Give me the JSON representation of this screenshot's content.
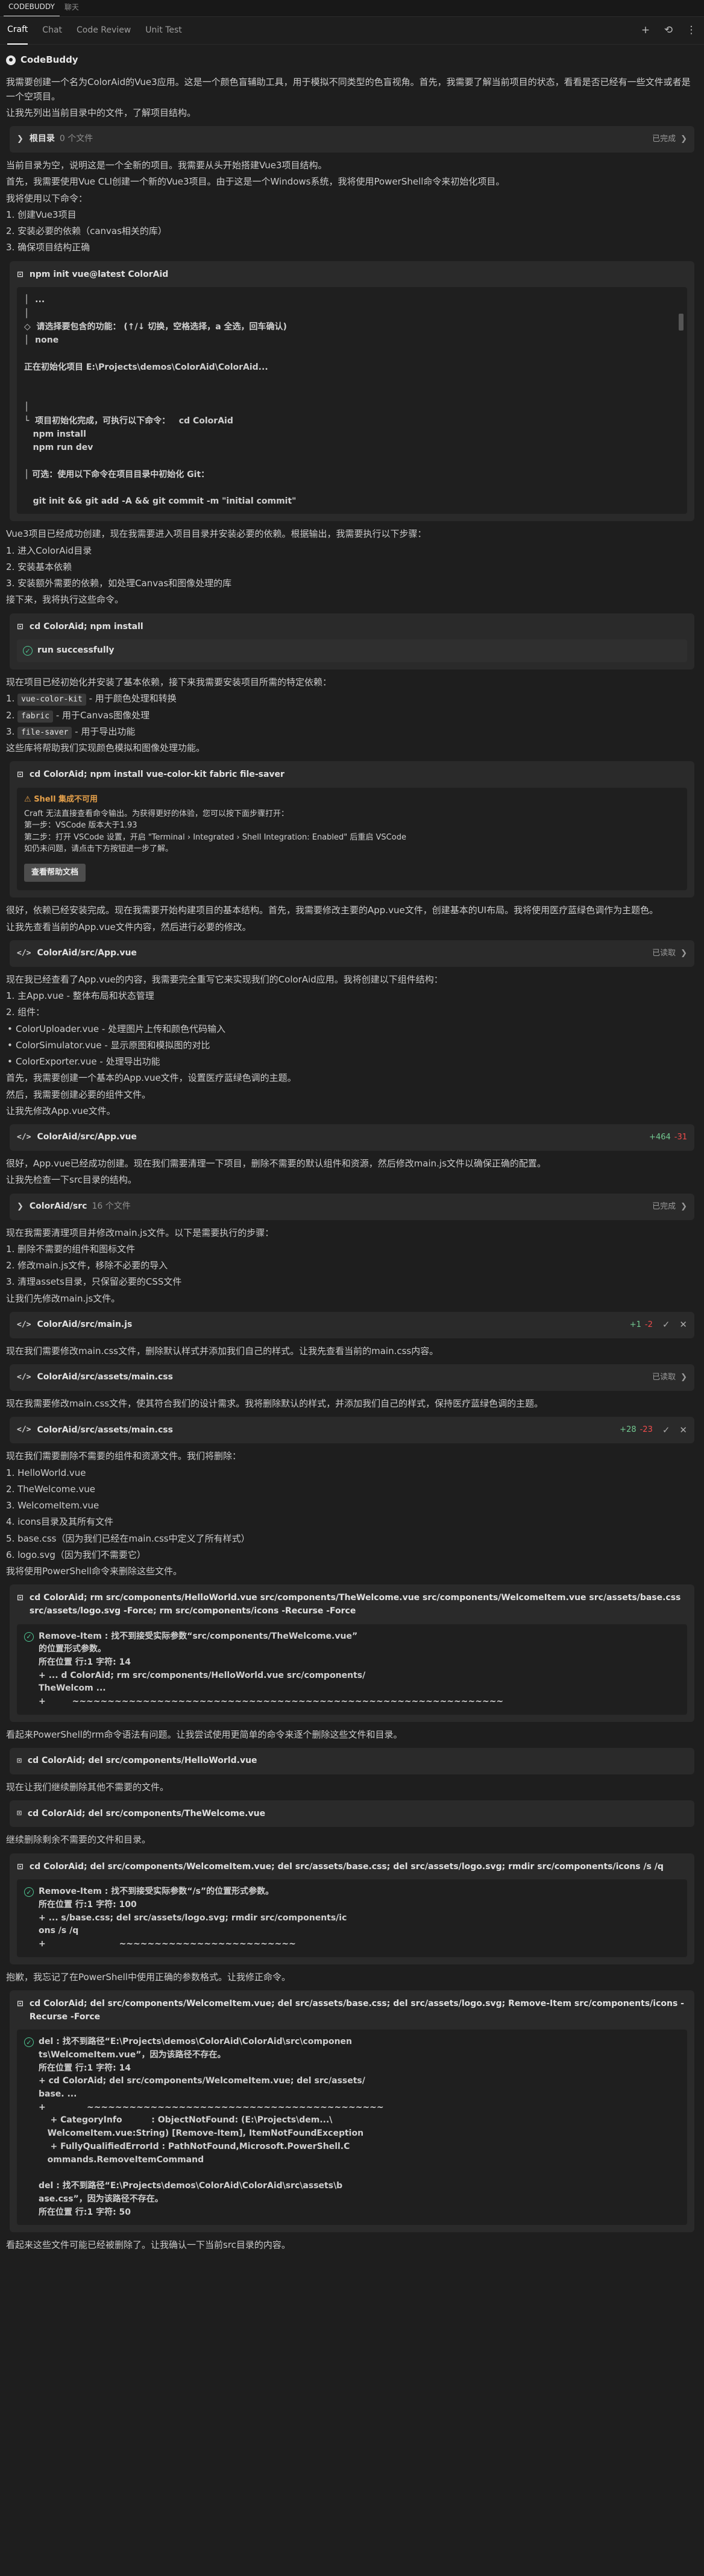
{
  "topbar": {
    "tabs": [
      "CODEBUDDY",
      "聊天"
    ]
  },
  "nav": {
    "tabs": [
      "Craft",
      "Chat",
      "Code Review",
      "Unit Test"
    ]
  },
  "header": {
    "name": "CodeBuddy"
  },
  "b1": {
    "text": "我需要创建一个名为ColorAid的Vue3应用。这是一个颜色盲辅助工具，用于模拟不同类型的色盲视角。首先，我需要了解当前项目的状态，看看是否已经有一些文件或者是一个空项目。"
  },
  "b2": {
    "text": "让我先列出当前目录中的文件，了解项目结构。"
  },
  "c1": {
    "title": "根目录",
    "meta": "0 个文件",
    "status": "已完成"
  },
  "b3": {
    "lines": [
      "当前目录为空，说明这是一个全新的项目。我需要从头开始搭建Vue3项目结构。",
      "首先，我需要使用Vue CLI创建一个新的Vue3项目。由于这是一个Windows系统，我将使用PowerShell命令来初始化项目。",
      "我将使用以下命令：",
      "1. 创建Vue3项目",
      "2. 安装必要的依赖（canvas相关的库）",
      "3. 确保项目结构正确"
    ]
  },
  "c2": {
    "cmd": "npm init vue@latest ColorAid",
    "lines": [
      "│  ...",
      "│  ",
      "◇  请选择要包含的功能： (↑/↓ 切换，空格选择，a 全选，回车确认)",
      "│  none",
      "",
      "正在初始化项目 E:\\Projects\\demos\\ColorAid\\ColorAid...",
      "",
      "",
      "",
      "│",
      "└  项目初始化完成，可执行以下命令：   cd ColorAid",
      "   npm install",
      "   npm run dev",
      "",
      "│ 可选：使用以下命令在项目目录中初始化 Git：",
      "",
      "   git init && git add -A && git commit -m \"initial commit\""
    ]
  },
  "b4": {
    "lines": [
      "Vue3项目已经成功创建，现在我需要进入项目目录并安装必要的依赖。根据输出，我需要执行以下步骤：",
      "1. 进入ColorAid目录",
      "2. 安装基本依赖",
      "3. 安装额外需要的依赖，如处理Canvas和图像处理的库",
      "接下来，我将执行这些命令。"
    ]
  },
  "c3": {
    "cmd": "cd ColorAid; npm install",
    "result": "run successfully"
  },
  "b5": {
    "intro": "现在项目已经初始化并安装了基本依赖，接下来我需要安装项目所需的特定依赖：",
    "items": [
      {
        "n": "1.",
        "code": "vue-color-kit",
        "desc": " - 用于颜色处理和转换"
      },
      {
        "n": "2.",
        "code": "fabric",
        "desc": " - 用于Canvas图像处理"
      },
      {
        "n": "3.",
        "code": "file-saver",
        "desc": " - 用于导出功能"
      }
    ],
    "outro": "这些库将帮助我们实现颜色模拟和图像处理功能。"
  },
  "c4": {
    "cmd": "cd ColorAid; npm install vue-color-kit fabric file-saver",
    "warn_title": "Shell 集成不可用",
    "warn_lines": [
      "Craft 无法直接查看命令输出。为获得更好的体验，您可以按下面步骤打开：",
      "第一步：VSCode 版本大于1.93",
      "第二步：打开 VSCode 设置，开启 \"Terminal › Integrated › Shell Integration: Enabled\" 后重启 VSCode",
      "如仍未问题，请点击下方按钮进一步了解。"
    ],
    "button": "查看帮助文档"
  },
  "b6": {
    "lines": [
      "很好，依赖已经安装完成。现在我需要开始构建项目的基本结构。首先，我需要修改主要的App.vue文件，创建基本的UI布局。我将使用医疗蓝绿色调作为主题色。",
      "让我先查看当前的App.vue文件内容，然后进行必要的修改。"
    ]
  },
  "c5": {
    "path": "ColorAid/src/App.vue",
    "status": "已读取"
  },
  "b7": {
    "intro": [
      "现在我已经查看了App.vue的内容，我需要完全重写它来实现我们的ColorAid应用。我将创建以下组件结构：",
      "1. 主App.vue - 整体布局和状态管理",
      "2. 组件："
    ],
    "items": [
      "ColorUploader.vue - 处理图片上传和颜色代码输入",
      "ColorSimulator.vue - 显示原图和模拟图的对比",
      "ColorExporter.vue - 处理导出功能"
    ],
    "outro": [
      "首先，我需要创建一个基本的App.vue文件，设置医疗蓝绿色调的主题。",
      "然后，我需要创建必要的组件文件。",
      "让我先修改App.vue文件。"
    ]
  },
  "c6": {
    "path": "ColorAid/src/App.vue",
    "add": "+464",
    "del": "-31"
  },
  "b8": {
    "lines": [
      "很好，App.vue已经成功创建。现在我们需要清理一下项目，删除不需要的默认组件和资源，然后修改main.js文件以确保正确的配置。",
      "让我先检查一下src目录的结构。"
    ]
  },
  "c7": {
    "title": "ColorAid/src",
    "meta": "16 个文件",
    "status": "已完成"
  },
  "b9": {
    "lines": [
      "现在我需要清理项目并修改main.js文件。以下是需要执行的步骤：",
      "1. 删除不需要的组件和图标文件",
      "2. 修改main.js文件，移除不必要的导入",
      "3. 清理assets目录，只保留必要的CSS文件",
      "让我们先修改main.js文件。"
    ]
  },
  "c8": {
    "path": "ColorAid/src/main.js",
    "add": "+1",
    "del": "-2"
  },
  "b10": {
    "text": "现在我们需要修改main.css文件，删除默认样式并添加我们自己的样式。让我先查看当前的main.css内容。"
  },
  "c9": {
    "path": "ColorAid/src/assets/main.css",
    "status": "已读取"
  },
  "b11": {
    "text": "现在我需要修改main.css文件，使其符合我们的设计需求。我将删除默认的样式，并添加我们自己的样式，保持医疗蓝绿色调的主题。"
  },
  "c10": {
    "path": "ColorAid/src/assets/main.css",
    "add": "+28",
    "del": "-23"
  },
  "b12": {
    "lines": [
      "现在我们需要删除不需要的组件和资源文件。我们将删除：",
      "1. HelloWorld.vue",
      "2. TheWelcome.vue",
      "3. WelcomeItem.vue",
      "4. icons目录及其所有文件",
      "5. base.css（因为我们已经在main.css中定义了所有样式）",
      "6. logo.svg（因为我们不需要它）",
      "我将使用PowerShell命令来删除这些文件。"
    ]
  },
  "c11": {
    "cmd": "cd ColorAid; rm src/components/HelloWorld.vue src/components/TheWelcome.vue src/components/WelcomeItem.vue src/assets/base.css src/assets/logo.svg -Force; rm src/components/icons -Recurse -Force",
    "result": [
      "Remove-Item : 找不到接受实际参数“src/components/TheWelcome.vue”",
      "的位置形式参数。",
      "所在位置 行:1 字符: 14",
      "+ ... d ColorAid; rm src/components/HelloWorld.vue src/components/",
      "TheWelcom ...",
      "+         ~~~~~~~~~~~~~~~~~~~~~~~~~~~~~~~~~~~~~~~~~~~~~~~~~~~~~~~~~~~~~"
    ]
  },
  "b13": {
    "text": "看起来PowerShell的rm命令语法有问题。让我尝试使用更简单的命令来逐个删除这些文件和目录。"
  },
  "c12": {
    "cmd": "cd ColorAid; del src/components/HelloWorld.vue"
  },
  "b14": {
    "text": "现在让我们继续删除其他不需要的文件。"
  },
  "c13": {
    "cmd": "cd ColorAid; del src/components/TheWelcome.vue"
  },
  "b15": {
    "text": "继续删除剩余不需要的文件和目录。"
  },
  "c14": {
    "cmd": "cd ColorAid; del src/components/WelcomeItem.vue; del src/assets/base.css; del src/assets/logo.svg; rmdir src/components/icons /s /q",
    "result": [
      "Remove-Item : 找不到接受实际参数“/s”的位置形式参数。",
      "所在位置 行:1 字符: 100",
      "+ ... s/base.css; del src/assets/logo.svg; rmdir src/components/ic",
      "ons /s /q",
      "+                         ~~~~~~~~~~~~~~~~~~~~~~~~~"
    ]
  },
  "b16": {
    "text": "抱歉，我忘记了在PowerShell中使用正确的参数格式。让我修正命令。"
  },
  "c15": {
    "cmd": "cd ColorAid; del src/components/WelcomeItem.vue; del src/assets/base.css; del src/assets/logo.svg; Remove-Item src/components/icons -Recurse -Force",
    "result": [
      "del : 找不到路径“E:\\Projects\\demos\\ColorAid\\ColorAid\\src\\componen",
      "ts\\WelcomeItem.vue”，因为该路径不存在。",
      "所在位置 行:1 字符: 14",
      "+ cd ColorAid; del src/components/WelcomeItem.vue; del src/assets/",
      "base. ...",
      "+              ~~~~~~~~~~~~~~~~~~~~~~~~~~~~~~~~~~~~~~~~~~",
      "    + CategoryInfo          : ObjectNotFound: (E:\\Projects\\dem...\\",
      "   WelcomeItem.vue:String) [Remove-Item], ItemNotFoundException",
      "    + FullyQualifiedErrorId : PathNotFound,Microsoft.PowerShell.C",
      "   ommands.RemoveItemCommand",
      "",
      "del : 找不到路径“E:\\Projects\\demos\\ColorAid\\ColorAid\\src\\assets\\b",
      "ase.css”，因为该路径不存在。",
      "所在位置 行:1 字符: 50"
    ]
  },
  "b17": {
    "text": "看起来这些文件可能已经被删除了。让我确认一下当前src目录的内容。"
  }
}
